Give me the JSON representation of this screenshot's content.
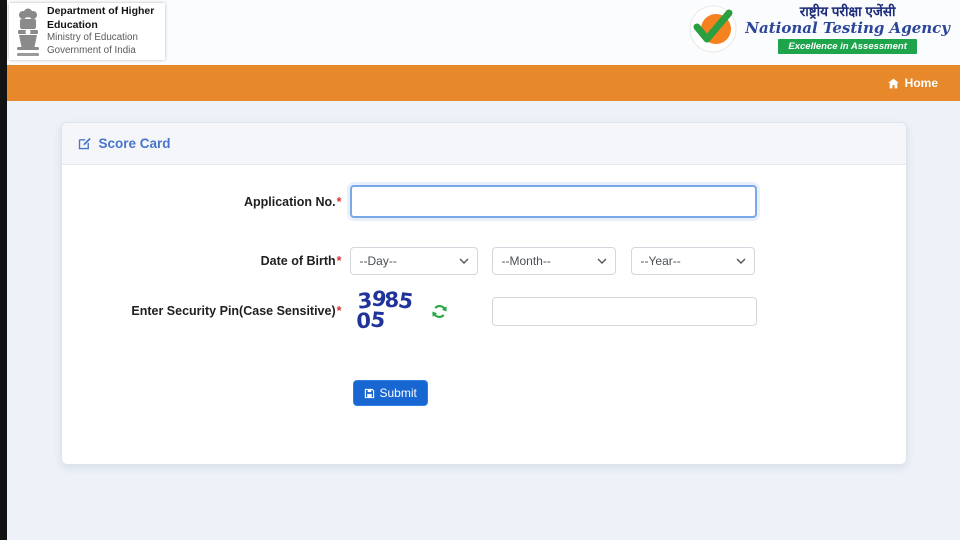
{
  "government_header": {
    "department": "Department of Higher Education",
    "ministry": "Ministry of Education",
    "country": "Government of India"
  },
  "nta_logo": {
    "hindi_name": "राष्ट्रीय परीक्षा एजेंसी",
    "english_name": "National Testing Agency",
    "tagline": "Excellence in Assessment"
  },
  "navbar": {
    "home_label": "Home"
  },
  "scorecard": {
    "title": "Score Card",
    "application_no": {
      "label": "Application No.",
      "required_mark": "*",
      "value": ""
    },
    "date_of_birth": {
      "label": "Date of Birth",
      "required_mark": "*",
      "day_placeholder": "--Day--",
      "month_placeholder": "--Month--",
      "year_placeholder": "--Year--"
    },
    "security_pin": {
      "label": "Enter Security Pin(Case Sensitive)",
      "required_mark": "*",
      "captcha_code": "398505",
      "value": ""
    },
    "submit_label": "Submit"
  },
  "colors": {
    "navbar_orange": "#e7882b",
    "submit_blue": "#1766d1",
    "captcha_blue": "#20339b",
    "refresh_green": "#28a745",
    "title_blue": "#4a74c9",
    "nta_orange": "#f5821f",
    "nta_green": "#1ea54c"
  }
}
